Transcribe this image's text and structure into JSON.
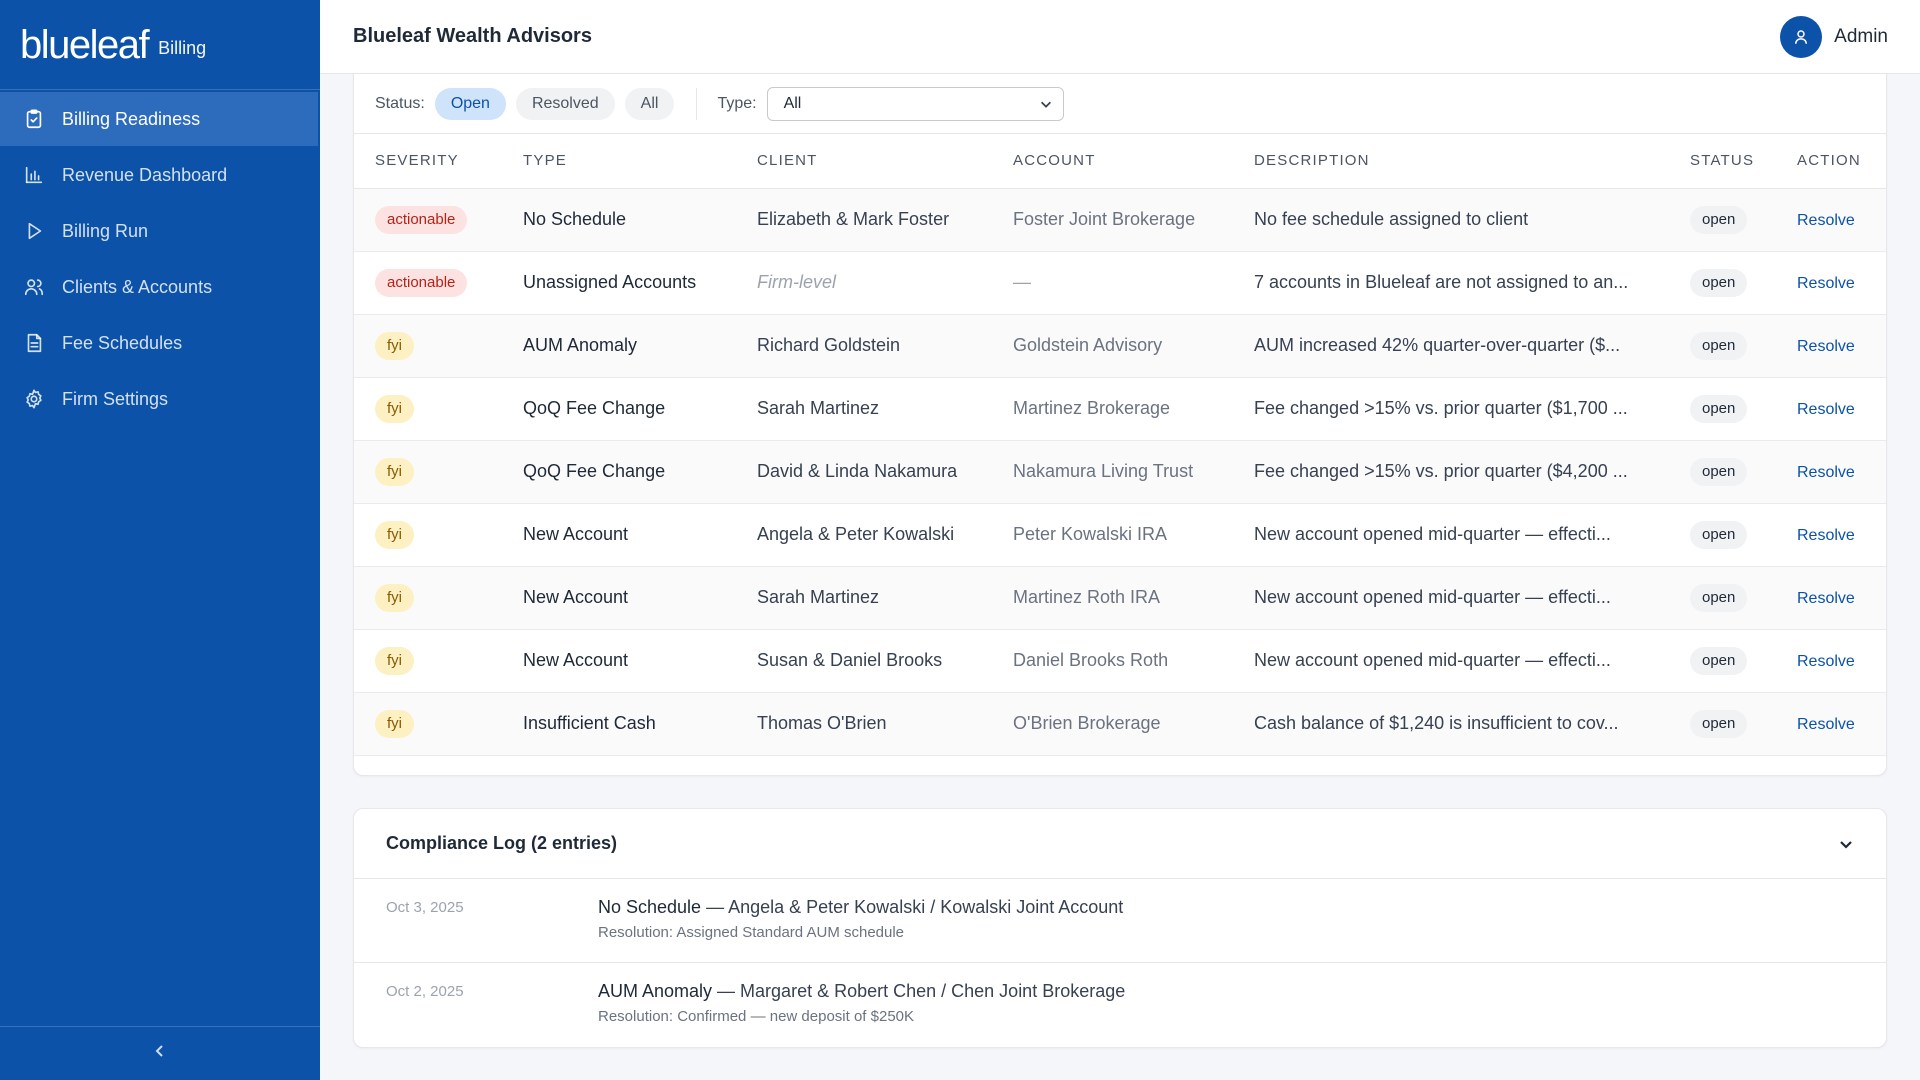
{
  "brand": {
    "logo": "blueleaf",
    "subtitle": "Billing"
  },
  "nav": [
    {
      "label": "Billing Readiness",
      "icon": "clipboard-check-icon",
      "active": true
    },
    {
      "label": "Revenue Dashboard",
      "icon": "bar-chart-icon",
      "active": false
    },
    {
      "label": "Billing Run",
      "icon": "play-icon",
      "active": false
    },
    {
      "label": "Clients & Accounts",
      "icon": "users-icon",
      "active": false
    },
    {
      "label": "Fee Schedules",
      "icon": "document-icon",
      "active": false
    },
    {
      "label": "Firm Settings",
      "icon": "gear-icon",
      "active": false
    }
  ],
  "header": {
    "firm": "Blueleaf Wealth Advisors",
    "user": "Admin"
  },
  "filters": {
    "status_label": "Status:",
    "status_options": [
      "Open",
      "Resolved",
      "All"
    ],
    "status_selected": "Open",
    "type_label": "Type:",
    "type_value": "All"
  },
  "table": {
    "headers": [
      "SEVERITY",
      "TYPE",
      "CLIENT",
      "ACCOUNT",
      "DESCRIPTION",
      "STATUS",
      "ACTION"
    ],
    "rows": [
      {
        "severity": "actionable",
        "type": "No Schedule",
        "client": "Elizabeth & Mark Foster",
        "account": "Foster Joint Brokerage",
        "description": "No fee schedule assigned to client",
        "status": "open",
        "action": "Resolve"
      },
      {
        "severity": "actionable",
        "type": "Unassigned Accounts",
        "client": "Firm-level",
        "account": "—",
        "description": "7 accounts in Blueleaf are not assigned to an...",
        "status": "open",
        "action": "Resolve"
      },
      {
        "severity": "fyi",
        "type": "AUM Anomaly",
        "client": "Richard Goldstein",
        "account": "Goldstein Advisory",
        "description": "AUM increased 42% quarter-over-quarter ($...",
        "status": "open",
        "action": "Resolve"
      },
      {
        "severity": "fyi",
        "type": "QoQ Fee Change",
        "client": "Sarah Martinez",
        "account": "Martinez Brokerage",
        "description": "Fee changed >15% vs. prior quarter ($1,700 ...",
        "status": "open",
        "action": "Resolve"
      },
      {
        "severity": "fyi",
        "type": "QoQ Fee Change",
        "client": "David & Linda Nakamura",
        "account": "Nakamura Living Trust",
        "description": "Fee changed >15% vs. prior quarter ($4,200 ...",
        "status": "open",
        "action": "Resolve"
      },
      {
        "severity": "fyi",
        "type": "New Account",
        "client": "Angela & Peter Kowalski",
        "account": "Peter Kowalski IRA",
        "description": "New account opened mid-quarter — effecti...",
        "status": "open",
        "action": "Resolve"
      },
      {
        "severity": "fyi",
        "type": "New Account",
        "client": "Sarah Martinez",
        "account": "Martinez Roth IRA",
        "description": "New account opened mid-quarter — effecti...",
        "status": "open",
        "action": "Resolve"
      },
      {
        "severity": "fyi",
        "type": "New Account",
        "client": "Susan & Daniel Brooks",
        "account": "Daniel Brooks Roth",
        "description": "New account opened mid-quarter — effecti...",
        "status": "open",
        "action": "Resolve"
      },
      {
        "severity": "fyi",
        "type": "Insufficient Cash",
        "client": "Thomas O'Brien",
        "account": "O'Brien Brokerage",
        "description": "Cash balance of $1,240 is insufficient to cov...",
        "status": "open",
        "action": "Resolve"
      }
    ]
  },
  "compliance": {
    "title": "Compliance Log (2 entries)",
    "entries": [
      {
        "date": "Oct 3, 2025",
        "type": "No Schedule",
        "detail": " — Angela & Peter Kowalski / Kowalski Joint Account",
        "resolution": "Resolution: Assigned Standard AUM schedule"
      },
      {
        "date": "Oct 2, 2025",
        "type": "AUM Anomaly",
        "detail": " — Margaret & Robert Chen / Chen Joint Brokerage",
        "resolution": "Resolution: Confirmed — new deposit of $250K"
      }
    ]
  },
  "colors": {
    "sidebar": "#0b52a8",
    "accent": "#0b52a8",
    "actionable": "#b42318",
    "fyi": "#8a5a00"
  }
}
